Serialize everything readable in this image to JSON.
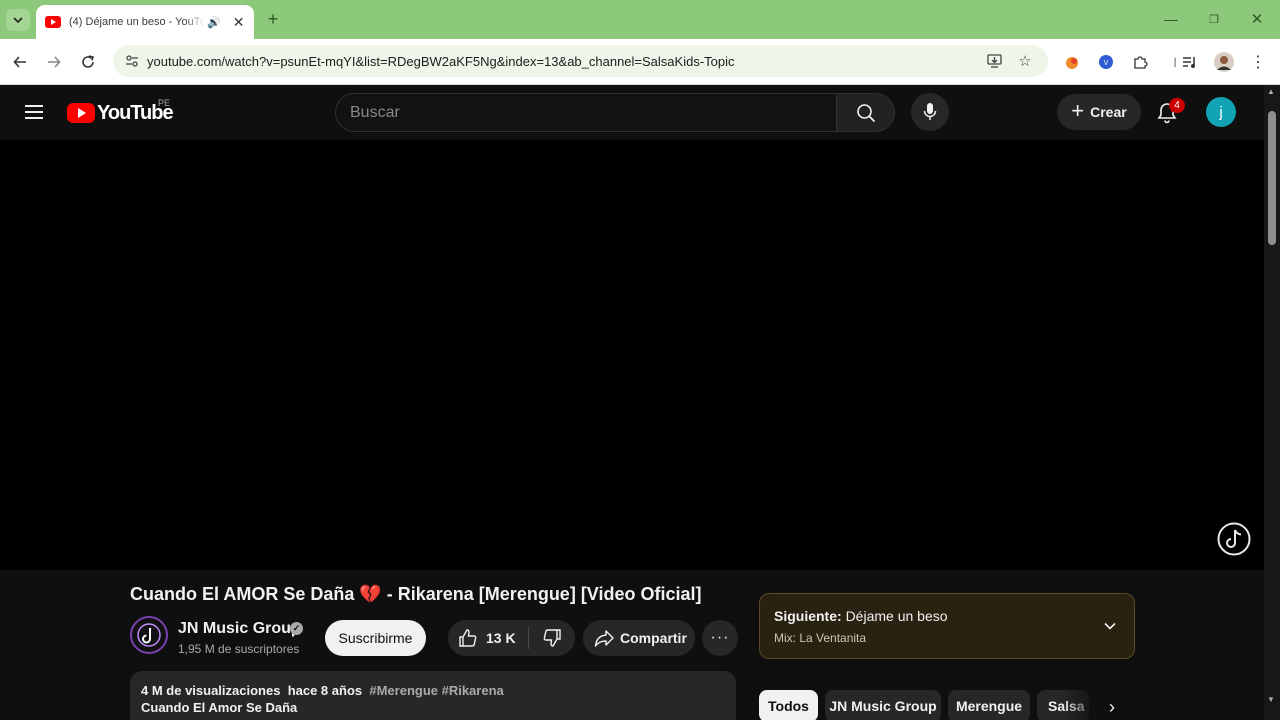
{
  "browser": {
    "tab": {
      "title": "(4) Déjame un beso - YouTube"
    },
    "omnibox": {
      "url": "youtube.com/watch?v=psunEt-mqYI&list=RDegBW2aKF5Ng&index=13&ab_channel=SalsaKids-Topic"
    }
  },
  "header": {
    "logo_text": "YouTube",
    "country_code": "PE",
    "search_placeholder": "Buscar",
    "create_label": "Crear",
    "notifications_count": "4",
    "avatar_letter": "j"
  },
  "video": {
    "title": "Cuando El AMOR Se Daña 💔 - Rikarena [Merengue] [Video Oficial]",
    "channel_name": "JN Music Group",
    "subscribers": "1,95 M de suscriptores",
    "subscribe_label": "Suscribirme",
    "like_count": "13 K",
    "share_label": "Compartir",
    "more_label": "···"
  },
  "description": {
    "views": "4 M de visualizaciones",
    "age": "hace 8 años",
    "tags": "#Merengue #Rikarena",
    "first_line": "Cuando El Amor Se Daña"
  },
  "up_next": {
    "label": "Siguiente:",
    "title": "Déjame un beso",
    "mix": "Mix: La Ventanita"
  },
  "chips": [
    "Todos",
    "JN Music Group",
    "Merengue",
    "Salsa"
  ],
  "colors": {
    "brand_red": "#ff0000",
    "avatar": "#12a3b5",
    "tabstrip": "#8cc97a"
  }
}
